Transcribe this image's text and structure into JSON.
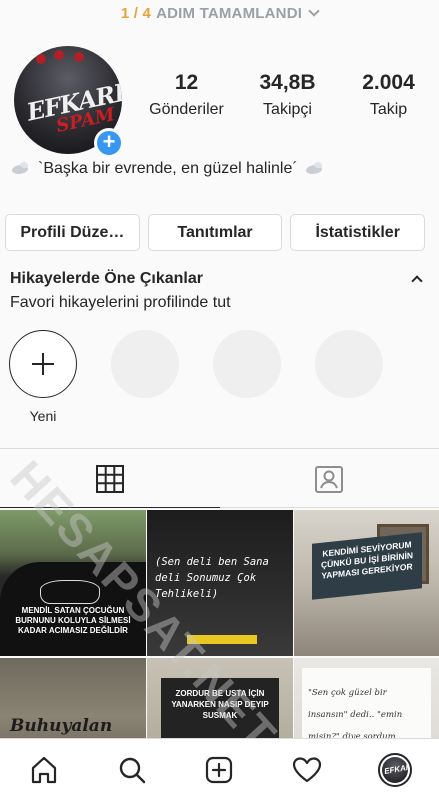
{
  "progress": {
    "count": "1 / 4",
    "label": "ADIM TAMAMLANDI"
  },
  "profile": {
    "avatar_text_top": "EFKARLI",
    "avatar_text_bottom": "SPAM",
    "bio": "`Başka bir evrende, en güzel halinle´"
  },
  "stats": [
    {
      "value": "12",
      "label": "Gönderiler"
    },
    {
      "value": "34,8B",
      "label": "Takipçi"
    },
    {
      "value": "2.004",
      "label": "Takip"
    }
  ],
  "actions": {
    "edit_profile": "Profili Düze…",
    "promotions": "Tanıtımlar",
    "insights": "İstatistikler"
  },
  "highlights": {
    "title": "Hikayelerde Öne Çıkanlar",
    "subtitle": "Favori hikayelerini profilinde tut",
    "new_label": "Yeni"
  },
  "watermark": "HESAPSAT.NET",
  "posts": [
    {
      "text": "MENDİL SATAN ÇOCUĞUN BURNUNU KOLUYLA SİLMESİ KADAR ACIMASIZ DEĞİLDİR"
    },
    {
      "text": "(Sen deli ben Sana deli Sonumuz Çok Tehlikeli)"
    },
    {
      "text": "KENDİMİ SEVİYORUM ÇÜNKÜ BU İŞİ BİRİNİN YAPMASI GEREKİYOR"
    },
    {
      "text": "Buhuyalan"
    },
    {
      "text": "ZORDUR BE USTA İÇİN YANARKEN NASIP DEYIP SUSMAK"
    },
    {
      "text": "\"Sen çok güzel bir insansın\" dedi.. \"emin misin?\" diye sordum.."
    }
  ],
  "colors": {
    "accent": "#3897f0",
    "progress_count": "#e8a23a",
    "progress_label": "#9aa0a6",
    "text": "#262626",
    "border": "#dbdbdb"
  },
  "nav": [
    "home-icon",
    "search-icon",
    "new-post-icon",
    "activity-heart-icon",
    "profile-avatar"
  ]
}
